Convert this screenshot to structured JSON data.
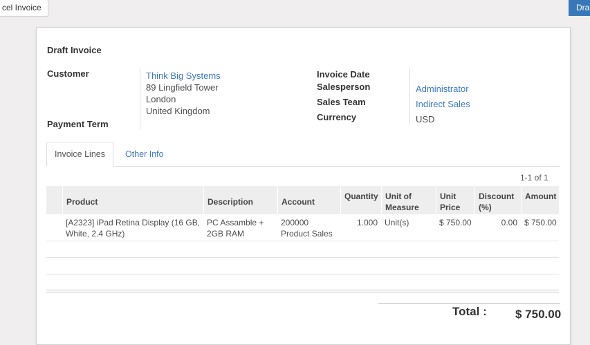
{
  "topbar": {
    "cancel_label": "cel Invoice",
    "draft_label": "Dra"
  },
  "form": {
    "title": "Draft Invoice",
    "customer_label": "Customer",
    "customer_name": "Think Big Systems",
    "address_line1": "89 Lingfield Tower",
    "address_line2": "London",
    "address_line3": "United Kingdom",
    "payment_term_label": "Payment Term",
    "invoice_date_label": "Invoice Date",
    "salesperson_label": "Salesperson",
    "salesperson_value": "Administrator",
    "sales_team_label": "Sales Team",
    "sales_team_value": "Indirect Sales",
    "currency_label": "Currency",
    "currency_value": "USD"
  },
  "tabs": [
    {
      "label": "Invoice Lines",
      "active": true
    },
    {
      "label": "Other Info",
      "active": false
    }
  ],
  "pager": "1-1 of 1",
  "table": {
    "headers": {
      "product": "Product",
      "description": "Description",
      "account": "Account",
      "quantity": "Quantity",
      "uom_line1": "Unit of",
      "uom_line2": "Measure",
      "price_line1": "Unit",
      "price_line2": "Price",
      "discount_line1": "Discount",
      "discount_line2": "(%)",
      "amount": "Amount"
    },
    "rows": [
      {
        "product_line1": "[A2323] iPad Retina Display (16 GB,",
        "product_line2": "White, 2.4 GHz)",
        "description_line1": "PC Assamble +",
        "description_line2": "2GB RAM",
        "account_line1": "200000",
        "account_line2": "Product Sales",
        "quantity": "1.000",
        "uom": "Unit(s)",
        "unit_price": "$ 750.00",
        "discount": "0.00",
        "amount": "$ 750.00"
      }
    ]
  },
  "totals": {
    "label": "Total :",
    "value": "$ 750.00"
  }
}
